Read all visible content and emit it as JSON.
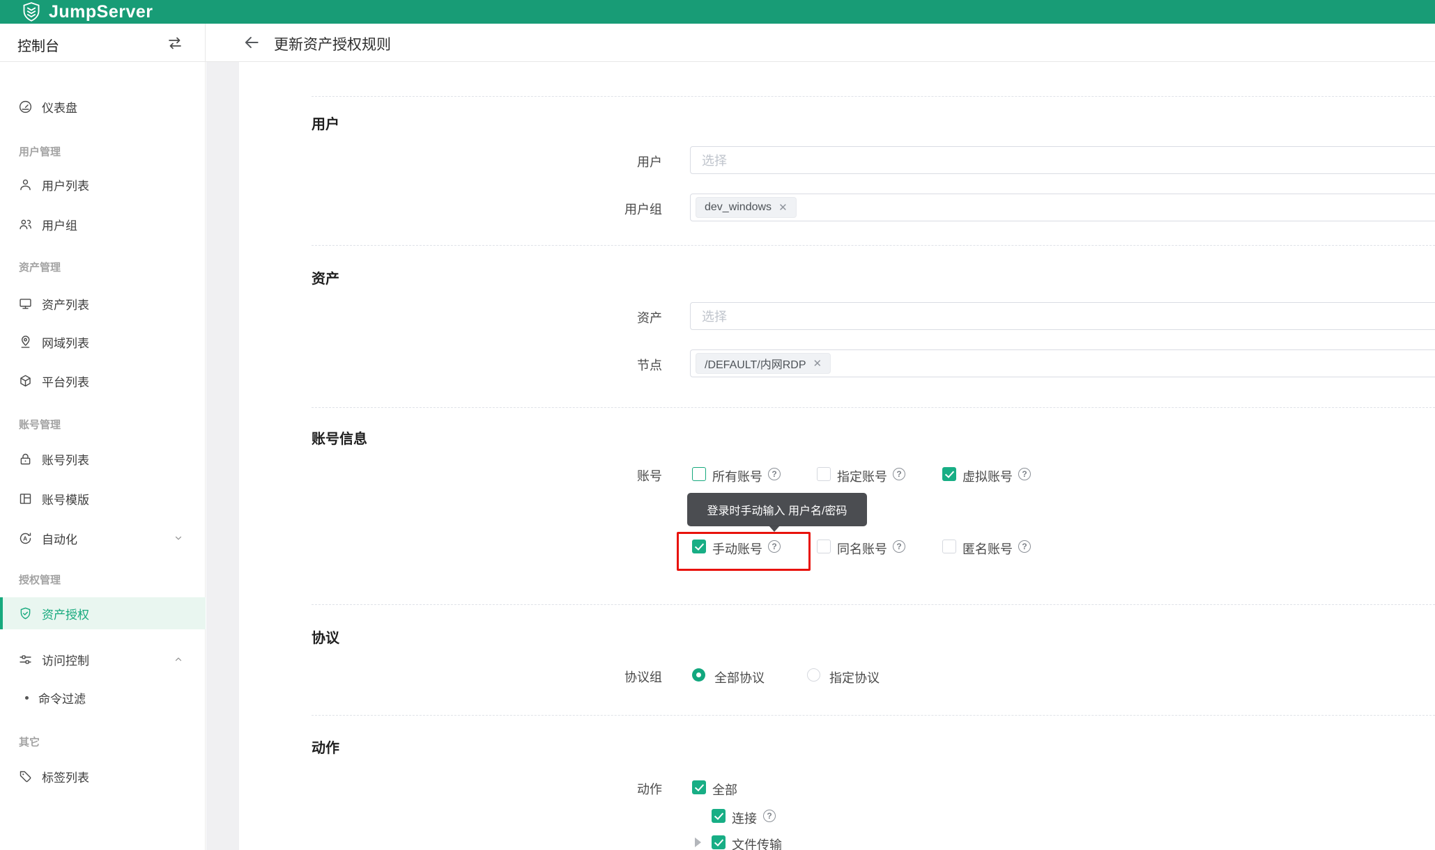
{
  "brand": {
    "logo_text": "JumpServer"
  },
  "topbar": {
    "console_label": "控制台"
  },
  "page_header": {
    "title": "更新资产授权规则"
  },
  "colors": {
    "brand_green": "#189C76",
    "accent_green": "#16A97D",
    "active_bg": "#E9F6F0",
    "red_highlight": "#E8120C",
    "tooltip_bg": "#44464A"
  },
  "sidebar": {
    "entries": [
      {
        "type": "item",
        "label": "仪表盘",
        "icon": "gauge-icon"
      },
      {
        "type": "section",
        "label": "用户管理"
      },
      {
        "type": "item",
        "label": "用户列表",
        "icon": "user-icon"
      },
      {
        "type": "item",
        "label": "用户组",
        "icon": "users-icon"
      },
      {
        "type": "section",
        "label": "资产管理"
      },
      {
        "type": "item",
        "label": "资产列表",
        "icon": "monitor-icon"
      },
      {
        "type": "item",
        "label": "网域列表",
        "icon": "map-pin-icon"
      },
      {
        "type": "item",
        "label": "平台列表",
        "icon": "cube-icon"
      },
      {
        "type": "section",
        "label": "账号管理"
      },
      {
        "type": "item",
        "label": "账号列表",
        "icon": "lock-icon"
      },
      {
        "type": "item",
        "label": "账号模版",
        "icon": "template-icon"
      },
      {
        "type": "item",
        "label": "自动化",
        "icon": "automation-icon",
        "expand": "collapsed"
      },
      {
        "type": "section",
        "label": "授权管理"
      },
      {
        "type": "item",
        "label": "资产授权",
        "icon": "shield-check-icon",
        "active": true
      },
      {
        "type": "item",
        "label": "访问控制",
        "icon": "sliders-icon",
        "expand": "expanded"
      },
      {
        "type": "subitem",
        "label": "命令过滤"
      },
      {
        "type": "section",
        "label": "其它"
      },
      {
        "type": "item",
        "label": "标签列表",
        "icon": "tag-icon"
      }
    ]
  },
  "form": {
    "user_section": {
      "title": "用户",
      "user_row": {
        "label": "用户",
        "placeholder": "选择"
      },
      "group_row": {
        "label": "用户组",
        "tag": "dev_windows",
        "tag_close": "✕"
      }
    },
    "asset_section": {
      "title": "资产",
      "asset_row": {
        "label": "资产",
        "placeholder": "选择"
      },
      "node_row": {
        "label": "节点",
        "tag": "/DEFAULT/内网RDP",
        "tag_close": "✕"
      }
    },
    "account_section": {
      "title": "账号信息",
      "label": "账号",
      "row1": [
        {
          "label": "所有账号",
          "state": "unchecked-green-border",
          "help": "?"
        },
        {
          "label": "指定账号",
          "state": "unchecked",
          "help": "?"
        },
        {
          "label": "虚拟账号",
          "state": "checked",
          "help": "?"
        }
      ],
      "tooltip": "登录时手动输入 用户名/密码",
      "row2": [
        {
          "label": "手动账号",
          "state": "checked",
          "help": "?",
          "highlighted": true
        },
        {
          "label": "同名账号",
          "state": "unchecked",
          "help": "?"
        },
        {
          "label": "匿名账号",
          "state": "unchecked",
          "help": "?"
        }
      ]
    },
    "protocol_section": {
      "title": "协议",
      "label": "协议组",
      "options": [
        {
          "label": "全部协议",
          "state": "selected"
        },
        {
          "label": "指定协议",
          "state": "unselected"
        }
      ]
    },
    "action_section": {
      "title": "动作",
      "label": "动作",
      "all_option": {
        "label": "全部",
        "state": "checked"
      },
      "connect_option": {
        "label": "连接",
        "state": "checked",
        "help": "?"
      },
      "file_transfer_option": {
        "label": "文件传输",
        "state": "checked"
      }
    }
  }
}
